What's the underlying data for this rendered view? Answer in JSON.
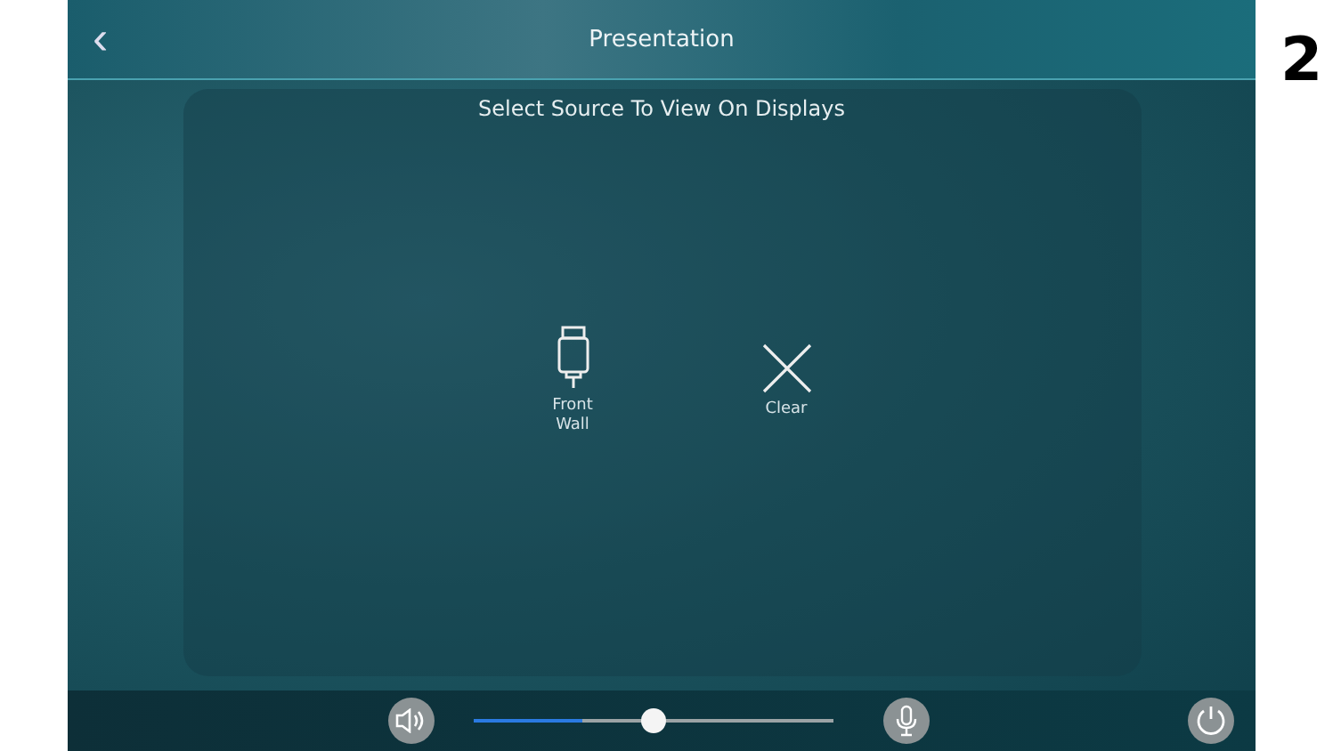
{
  "header": {
    "title": "Presentation",
    "back": "‹"
  },
  "panel": {
    "heading": "Select Source To View On Displays",
    "sources": [
      {
        "kind": "source",
        "label": "Front Wall"
      },
      {
        "kind": "clear",
        "label": "Clear"
      }
    ]
  },
  "footer": {
    "meter": {
      "level": 0.3
    },
    "volume": {
      "level": 0.5
    }
  },
  "page_number": "2"
}
